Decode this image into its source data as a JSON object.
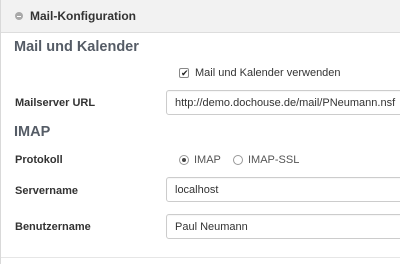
{
  "panel": {
    "title": "Mail-Konfiguration",
    "collapse_icon": "minus-circle-icon"
  },
  "mail_section": {
    "title": "Mail und Kalender",
    "enable_checkbox": {
      "label": "Mail und Kalender verwenden",
      "checked": true
    },
    "mailserver_url": {
      "label": "Mailserver URL",
      "value": "http://demo.dochouse.de/mail/PNeumann.nsf"
    }
  },
  "imap_section": {
    "title": "IMAP",
    "protocol": {
      "label": "Protokoll",
      "options": [
        {
          "label": "IMAP",
          "selected": true
        },
        {
          "label": "IMAP-SSL",
          "selected": false
        }
      ]
    },
    "servername": {
      "label": "Servername",
      "value": "localhost"
    },
    "username": {
      "label": "Benutzername",
      "value": "Paul Neumann"
    }
  }
}
